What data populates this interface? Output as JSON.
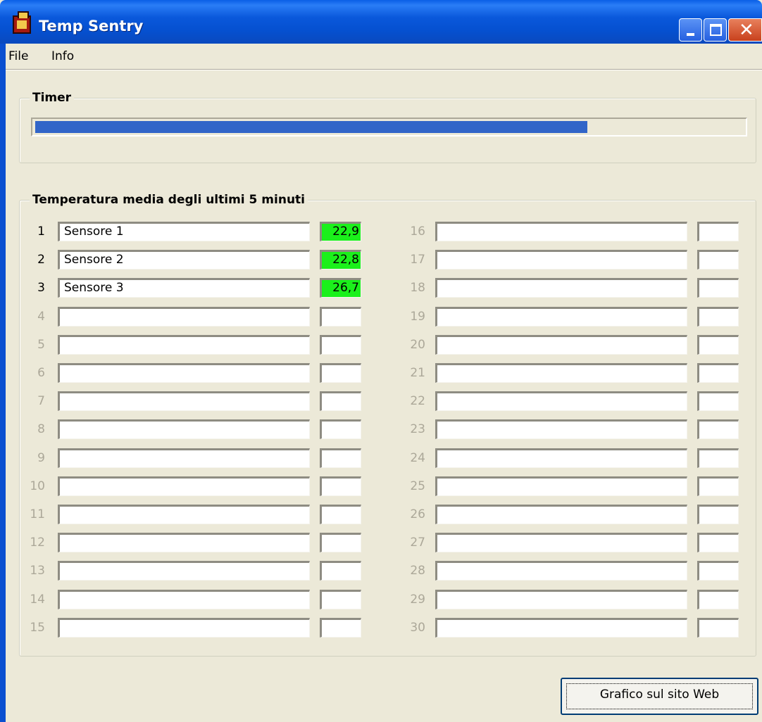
{
  "window": {
    "title": "Temp Sentry"
  },
  "menu": [
    "File",
    "Info"
  ],
  "timer": {
    "label": "Timer",
    "progress_fraction": 0.78
  },
  "sensors_group": {
    "label": "Temperatura media degli ultimi 5 minuti"
  },
  "sensors_left": [
    {
      "num": "1",
      "name": "Sensore 1",
      "temp": "22,9",
      "active": true
    },
    {
      "num": "2",
      "name": "Sensore 2",
      "temp": "22,8",
      "active": true
    },
    {
      "num": "3",
      "name": "Sensore 3",
      "temp": "26,7",
      "active": true
    },
    {
      "num": "4",
      "name": "",
      "temp": "",
      "active": false
    },
    {
      "num": "5",
      "name": "",
      "temp": "",
      "active": false
    },
    {
      "num": "6",
      "name": "",
      "temp": "",
      "active": false
    },
    {
      "num": "7",
      "name": "",
      "temp": "",
      "active": false
    },
    {
      "num": "8",
      "name": "",
      "temp": "",
      "active": false
    },
    {
      "num": "9",
      "name": "",
      "temp": "",
      "active": false
    },
    {
      "num": "10",
      "name": "",
      "temp": "",
      "active": false
    },
    {
      "num": "11",
      "name": "",
      "temp": "",
      "active": false
    },
    {
      "num": "12",
      "name": "",
      "temp": "",
      "active": false
    },
    {
      "num": "13",
      "name": "",
      "temp": "",
      "active": false
    },
    {
      "num": "14",
      "name": "",
      "temp": "",
      "active": false
    },
    {
      "num": "15",
      "name": "",
      "temp": "",
      "active": false
    }
  ],
  "sensors_right": [
    {
      "num": "16",
      "name": "",
      "temp": "",
      "active": false
    },
    {
      "num": "17",
      "name": "",
      "temp": "",
      "active": false
    },
    {
      "num": "18",
      "name": "",
      "temp": "",
      "active": false
    },
    {
      "num": "19",
      "name": "",
      "temp": "",
      "active": false
    },
    {
      "num": "20",
      "name": "",
      "temp": "",
      "active": false
    },
    {
      "num": "21",
      "name": "",
      "temp": "",
      "active": false
    },
    {
      "num": "22",
      "name": "",
      "temp": "",
      "active": false
    },
    {
      "num": "23",
      "name": "",
      "temp": "",
      "active": false
    },
    {
      "num": "24",
      "name": "",
      "temp": "",
      "active": false
    },
    {
      "num": "25",
      "name": "",
      "temp": "",
      "active": false
    },
    {
      "num": "26",
      "name": "",
      "temp": "",
      "active": false
    },
    {
      "num": "27",
      "name": "",
      "temp": "",
      "active": false
    },
    {
      "num": "28",
      "name": "",
      "temp": "",
      "active": false
    },
    {
      "num": "29",
      "name": "",
      "temp": "",
      "active": false
    },
    {
      "num": "30",
      "name": "",
      "temp": "",
      "active": false
    }
  ],
  "colors": {
    "temp_highlight": "#1BF01B",
    "progress": "#3165C8"
  },
  "button": {
    "label": "Grafico sul sito Web"
  }
}
